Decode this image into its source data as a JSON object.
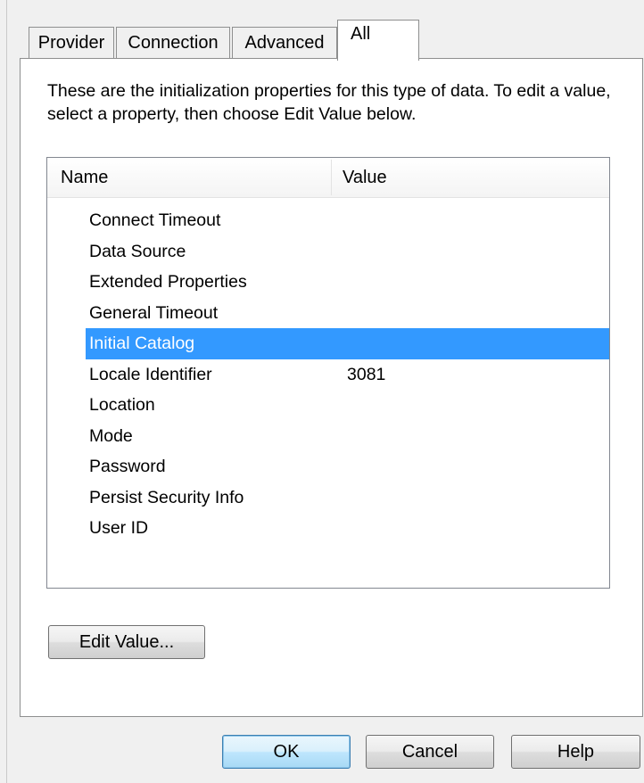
{
  "tabs": [
    {
      "label": "Provider"
    },
    {
      "label": "Connection"
    },
    {
      "label": "Advanced"
    },
    {
      "label": "All"
    }
  ],
  "active_tab": "All",
  "description": "These are the initialization properties for this type of data. To edit a value, select a property, then choose Edit Value below.",
  "properties": {
    "columns": {
      "name": "Name",
      "value": "Value"
    },
    "rows": [
      {
        "name": "Connect Timeout",
        "value": ""
      },
      {
        "name": "Data Source",
        "value": ""
      },
      {
        "name": "Extended Properties",
        "value": ""
      },
      {
        "name": "General Timeout",
        "value": ""
      },
      {
        "name": "Initial Catalog",
        "value": ""
      },
      {
        "name": "Locale Identifier",
        "value": "3081"
      },
      {
        "name": "Location",
        "value": ""
      },
      {
        "name": "Mode",
        "value": ""
      },
      {
        "name": "Password",
        "value": ""
      },
      {
        "name": "Persist Security Info",
        "value": ""
      },
      {
        "name": "User ID",
        "value": ""
      }
    ],
    "selected": "Initial Catalog"
  },
  "buttons": {
    "edit_value": "Edit Value...",
    "ok": "OK",
    "cancel": "Cancel",
    "help": "Help"
  },
  "colors": {
    "selection": "#3399ff",
    "panel_background": "#ffffff",
    "dialog_background": "#f0f0f0"
  }
}
